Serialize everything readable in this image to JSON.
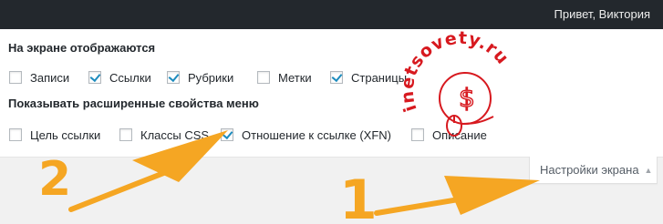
{
  "admin_bar": {
    "greeting": "Привет, Виктория"
  },
  "screen_options": {
    "heading_boxes": "На экране отображаются",
    "boxes": [
      {
        "label": "Записи",
        "checked": false
      },
      {
        "label": "Ссылки",
        "checked": true
      },
      {
        "label": "Рубрики",
        "checked": true
      },
      {
        "label": "Метки",
        "checked": false
      },
      {
        "label": "Страницы",
        "checked": true
      }
    ],
    "heading_advanced": "Показывать расширенные свойства меню",
    "advanced": [
      {
        "label": "Цель ссылки",
        "checked": false
      },
      {
        "label": "Классы CSS",
        "checked": false
      },
      {
        "label": "Отношение к ссылке (XFN)",
        "checked": true
      },
      {
        "label": "Описание",
        "checked": false
      }
    ]
  },
  "screen_options_tab": {
    "label": "Настройки экрана",
    "arrow_icon": "arrow-up-icon"
  },
  "annotations": {
    "marker_1": "1",
    "marker_2": "2",
    "color": "#f5a623"
  },
  "watermark": {
    "text": "inetsovety.ru",
    "color": "#d7191f"
  }
}
